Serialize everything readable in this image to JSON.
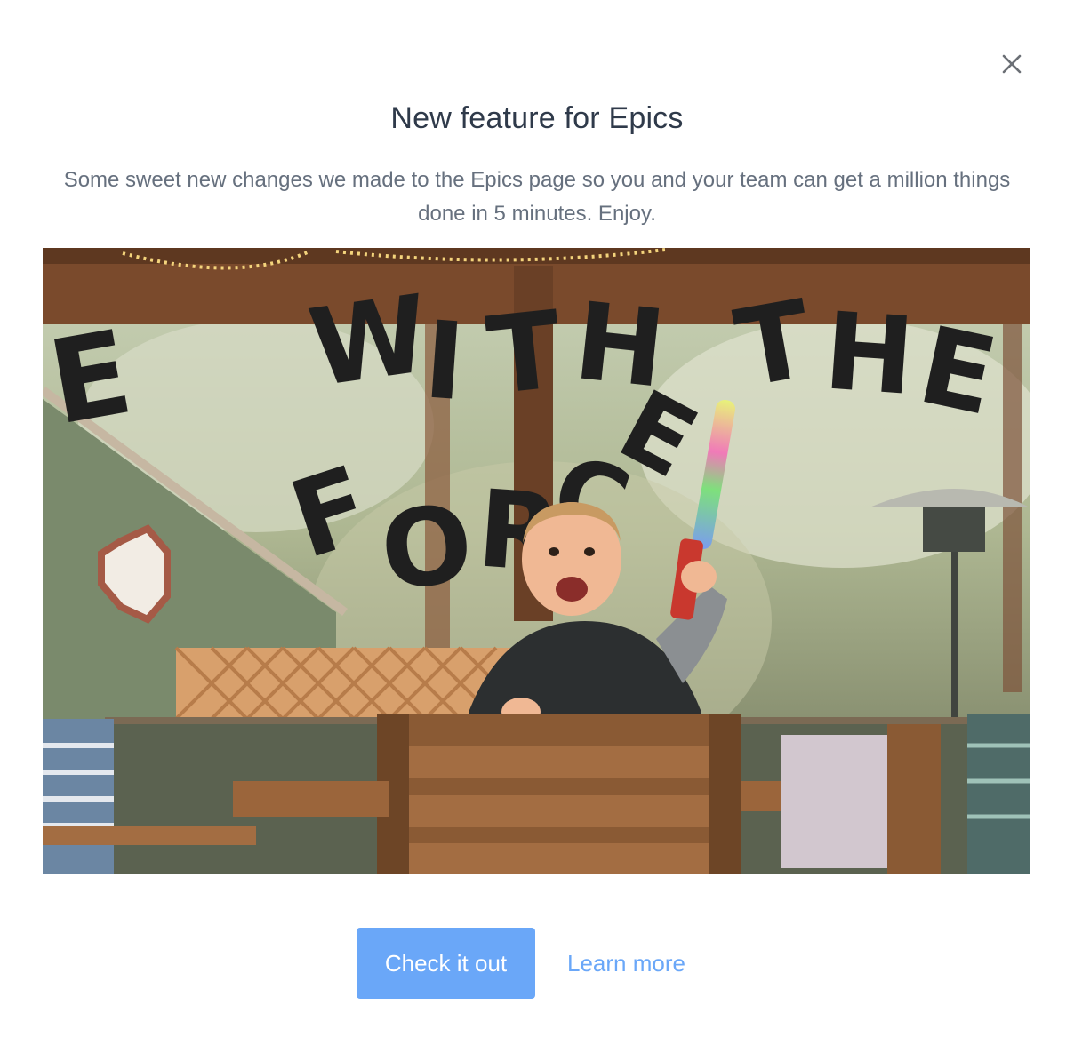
{
  "dialog": {
    "title": "New feature for Epics",
    "description": "Some sweet new changes we made to the Epics page so you and your team can get a million things done in 5 minutes. Enjoy.",
    "close_icon": "close-icon",
    "image_alt": "Toddler holding a toy lightsaber under a \"WITH THE FORCE\" balloon banner",
    "primary_button_label": "Check it out",
    "secondary_link_label": "Learn more"
  },
  "colors": {
    "title": "#2f3a4a",
    "body_text": "#66707e",
    "accent": "#6aa7f8",
    "close_icon": "#6b6f75"
  }
}
